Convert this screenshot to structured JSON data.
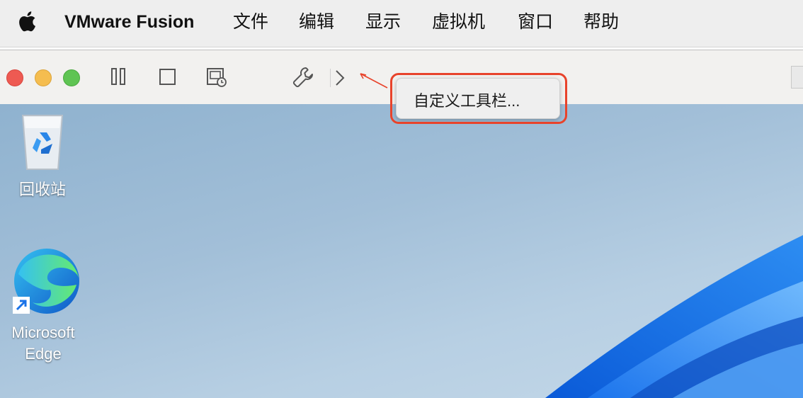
{
  "menubar": {
    "app_name": "VMware Fusion",
    "items": [
      "文件",
      "编辑",
      "显示",
      "虚拟机",
      "窗口",
      "帮助"
    ]
  },
  "toolbar": {
    "buttons": [
      "pause-icon",
      "stop-icon",
      "snapshot-icon",
      "settings-wrench-icon",
      "chevron-right-icon"
    ]
  },
  "context_menu": {
    "item": "自定义工具栏..."
  },
  "desktop": {
    "icons": [
      {
        "label": "回收站"
      },
      {
        "label_line1": "Microsoft",
        "label_line2": "Edge"
      }
    ]
  },
  "colors": {
    "highlight": "#e8432b",
    "traffic_red": "#ee5a52",
    "traffic_yellow": "#f5bd4f",
    "traffic_green": "#5fc453"
  }
}
